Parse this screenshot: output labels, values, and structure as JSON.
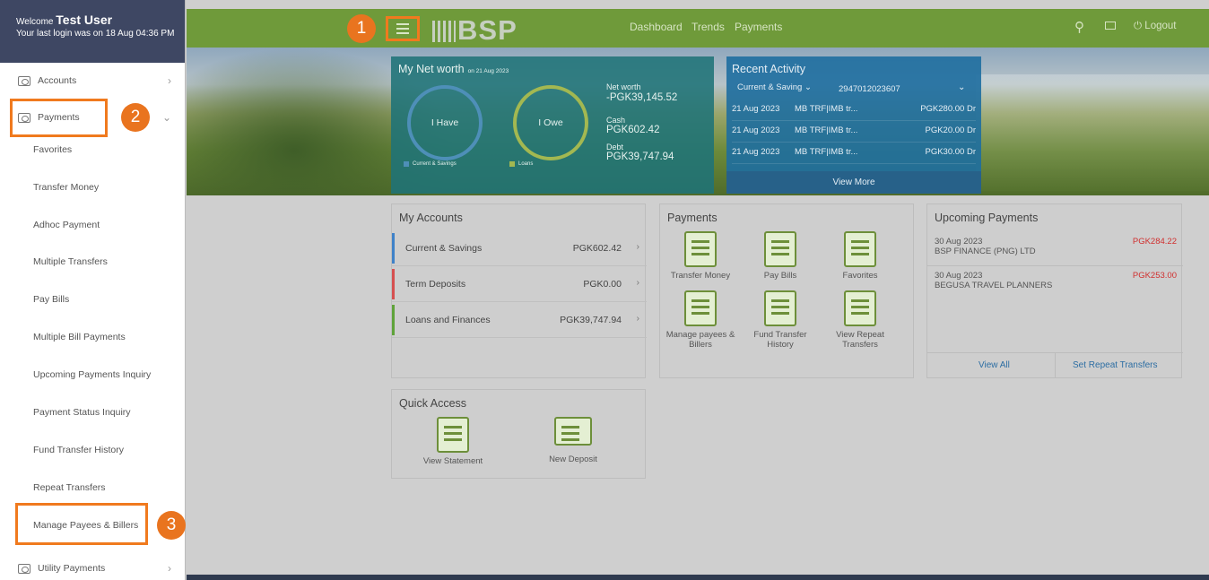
{
  "sidebar": {
    "welcome_prefix": "Welcome",
    "user_name": "Test User",
    "last_login": "Your last login was on 18 Aug 04:36 PM",
    "accounts": "Accounts",
    "payments": "Payments",
    "sub_items": [
      "Favorites",
      "Transfer Money",
      "Adhoc Payment",
      "Multiple Transfers",
      "Pay Bills",
      "Multiple Bill Payments",
      "Upcoming Payments Inquiry",
      "Payment Status Inquiry",
      "Fund Transfer History",
      "Repeat Transfers",
      "Manage Payees & Billers"
    ],
    "utility_payments": "Utility Payments"
  },
  "topbar": {
    "logo": "BSP",
    "nav": [
      "Dashboard",
      "Trends",
      "Payments"
    ],
    "logout": "Logout"
  },
  "networth": {
    "title": "My Net worth",
    "date": "on 21 Aug 2023",
    "have": "I Have",
    "owe": "I Owe",
    "legend_savings": "Current & Savings",
    "legend_loans": "Loans",
    "net_label": "Net worth",
    "net_value": "-PGK39,145.52",
    "cash_label": "Cash",
    "cash_value": "PGK602.42",
    "debt_label": "Debt",
    "debt_value": "PGK39,747.94"
  },
  "recent": {
    "title": "Recent Activity",
    "filter": "Current & Saving",
    "account": "2947012023607",
    "rows": [
      {
        "date": "21 Aug 2023",
        "desc": "MB TRF|IMB tr...",
        "amt": "PGK280.00 Dr"
      },
      {
        "date": "21 Aug 2023",
        "desc": "MB TRF|IMB tr...",
        "amt": "PGK20.00 Dr"
      },
      {
        "date": "21 Aug 2023",
        "desc": "MB TRF|IMB tr...",
        "amt": "PGK30.00 Dr"
      }
    ],
    "view_more": "View More"
  },
  "my_accounts": {
    "title": "My Accounts",
    "rows": [
      {
        "name": "Current & Savings",
        "amount": "PGK602.42",
        "color": "#3f82c8"
      },
      {
        "name": "Term Deposits",
        "amount": "PGK0.00",
        "color": "#d65050"
      },
      {
        "name": "Loans and Finances",
        "amount": "PGK39,747.94",
        "color": "#5fa33a"
      }
    ]
  },
  "payments_card": {
    "title": "Payments",
    "tiles": [
      "Transfer Money",
      "Pay Bills",
      "Favorites",
      "Manage payees & Billers",
      "Fund Transfer History",
      "View Repeat Transfers"
    ]
  },
  "upcoming": {
    "title": "Upcoming Payments",
    "items": [
      {
        "date": "30 Aug 2023",
        "payee": "BSP FINANCE (PNG) LTD",
        "amount": "PGK284.22"
      },
      {
        "date": "30 Aug 2023",
        "payee": "BEGUSA TRAVEL PLANNERS",
        "amount": "PGK253.00"
      }
    ],
    "view_all": "View All",
    "set_repeat": "Set Repeat Transfers"
  },
  "quick_access": {
    "title": "Quick Access",
    "tiles": [
      "View Statement",
      "New Deposit"
    ]
  },
  "steps": [
    "1",
    "2",
    "3"
  ]
}
